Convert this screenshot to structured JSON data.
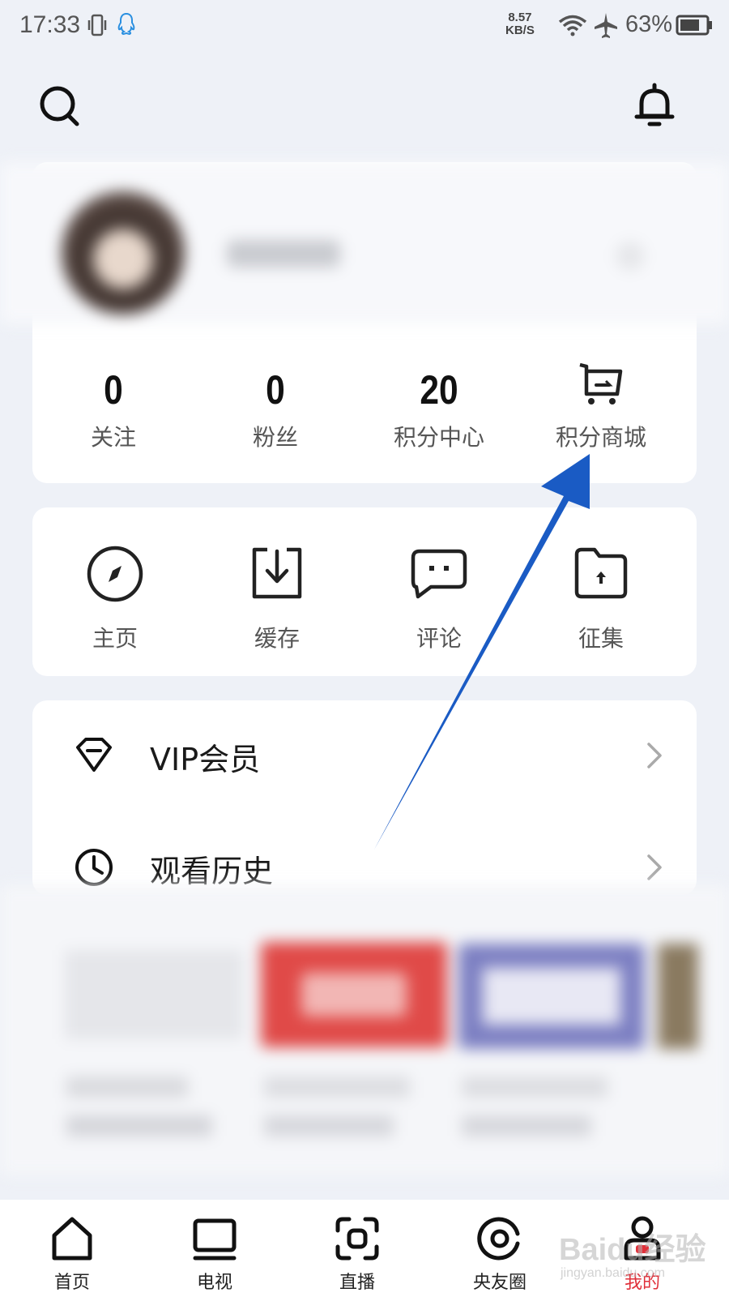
{
  "status_bar": {
    "time": "17:33",
    "speed_value": "8.57",
    "speed_unit": "KB/S",
    "battery": "63%"
  },
  "profile": {
    "stats": [
      {
        "value": "0",
        "label": "关注"
      },
      {
        "value": "0",
        "label": "粉丝"
      },
      {
        "value": "20",
        "label": "积分中心"
      }
    ],
    "points_mall_label": "积分商城"
  },
  "shortcuts": [
    {
      "label": "主页",
      "icon": "compass-icon"
    },
    {
      "label": "缓存",
      "icon": "download-icon"
    },
    {
      "label": "评论",
      "icon": "comment-icon"
    },
    {
      "label": "征集",
      "icon": "folder-upload-icon"
    }
  ],
  "menu": [
    {
      "label": "VIP会员",
      "icon": "diamond-icon"
    },
    {
      "label": "观看历史",
      "icon": "clock-icon"
    }
  ],
  "bottom_nav": [
    {
      "label": "首页",
      "icon": "home-icon"
    },
    {
      "label": "电视",
      "icon": "tv-icon"
    },
    {
      "label": "直播",
      "icon": "live-icon"
    },
    {
      "label": "央友圈",
      "icon": "circle-icon"
    },
    {
      "label": "我的",
      "icon": "profile-icon",
      "active": true
    }
  ],
  "watermark": {
    "text": "Baidu经验",
    "url_text": "jingyan.baidu.com"
  },
  "colors": {
    "accent": "#e0303a",
    "annotation_arrow": "#1a5bc4",
    "background": "#eef1f7"
  }
}
